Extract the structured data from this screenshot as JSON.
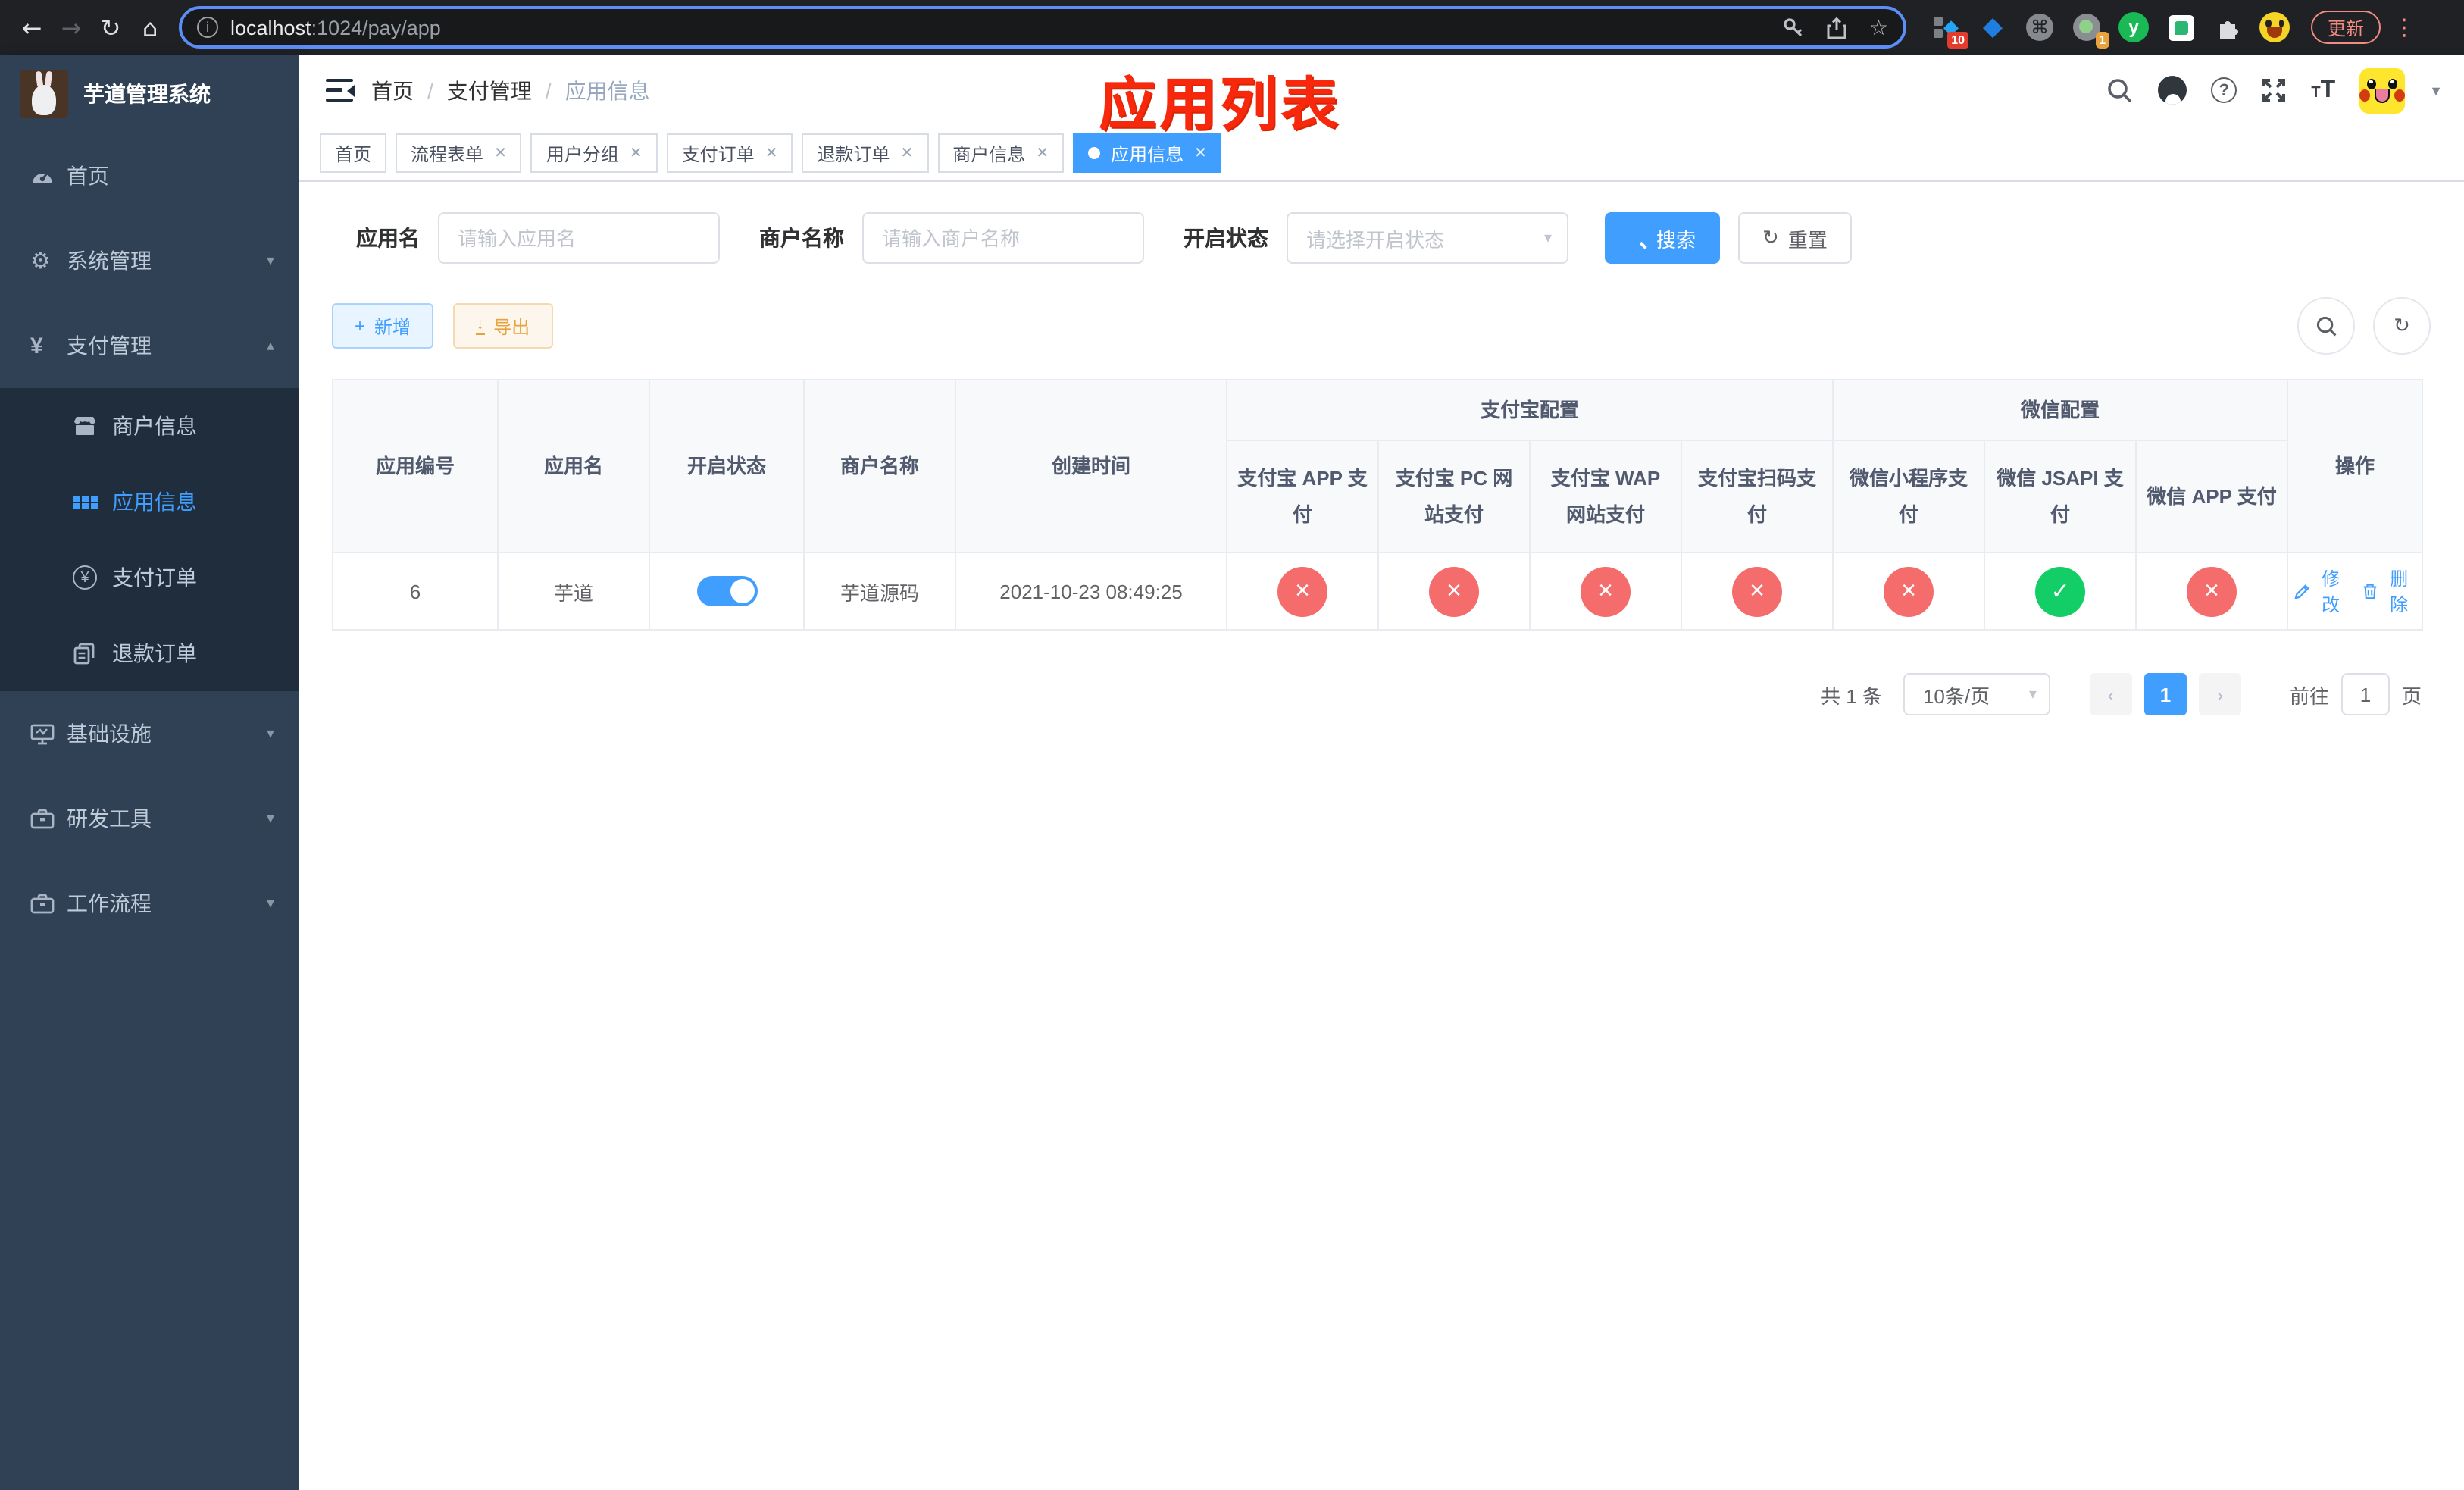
{
  "browser": {
    "url_host": "localhost",
    "url_rest": ":1024/pay/app",
    "update_label": "更新",
    "ext_badge_10": "10",
    "ext_badge_1": "1",
    "ycirc_label": "y"
  },
  "colors": {
    "accent": "#409eff",
    "success": "#13ce66",
    "danger": "#f56c6c",
    "annotation_red": "#f8280c",
    "export_orange": "#e6a23c",
    "sidebar_bg": "#304156",
    "submenu_bg": "#1f2d3d"
  },
  "sidebar": {
    "title": "芋道管理系统",
    "items": {
      "home": "首页",
      "system": "系统管理",
      "payment": "支付管理",
      "infra": "基础设施",
      "devtools": "研发工具",
      "workflow": "工作流程"
    },
    "payment_children": {
      "merchant": "商户信息",
      "app": "应用信息",
      "order": "支付订单",
      "refund": "退款订单"
    }
  },
  "header": {
    "breadcrumb": [
      "首页",
      "支付管理",
      "应用信息"
    ],
    "annotation": "应用列表"
  },
  "tabs": [
    {
      "label": "首页"
    },
    {
      "label": "流程表单"
    },
    {
      "label": "用户分组"
    },
    {
      "label": "支付订单"
    },
    {
      "label": "退款订单"
    },
    {
      "label": "商户信息"
    },
    {
      "label": "应用信息"
    }
  ],
  "filters": {
    "app_name_label": "应用名",
    "app_name_placeholder": "请输入应用名",
    "merchant_label": "商户名称",
    "merchant_placeholder": "请输入商户名称",
    "status_label": "开启状态",
    "status_placeholder": "请选择开启状态",
    "search_label": "搜索",
    "reset_label": "重置"
  },
  "toolbar": {
    "add_label": "新增",
    "export_label": "导出"
  },
  "table": {
    "columns": [
      "应用编号",
      "应用名",
      "开启状态",
      "商户名称",
      "创建时间"
    ],
    "groups": {
      "alipay": {
        "label": "支付宝配置",
        "cols": [
          "支付宝 APP 支付",
          "支付宝 PC 网站支付",
          "支付宝 WAP 网站支付",
          "支付宝扫码支付"
        ]
      },
      "wechat": {
        "label": "微信配置",
        "cols": [
          "微信小程序支付",
          "微信 JSAPI 支付",
          "微信 APP 支付"
        ]
      }
    },
    "actions_label": "操作",
    "rows": [
      {
        "id": "6",
        "name": "芋道",
        "enabled": true,
        "merchant": "芋道源码",
        "created": "2021-10-23 08:49:25",
        "alipay_app": "no",
        "alipay_pc": "no",
        "alipay_wap": "no",
        "alipay_scan": "no",
        "wx_mini": "no",
        "wx_jsapi": "yes",
        "wx_app": "no",
        "edit_label": "修改",
        "delete_label": "删除"
      }
    ]
  },
  "pagination": {
    "total": "共 1 条",
    "page_size": "10条/页",
    "current": "1",
    "goto_label": "前往",
    "goto_value": "1",
    "page_unit": "页"
  }
}
